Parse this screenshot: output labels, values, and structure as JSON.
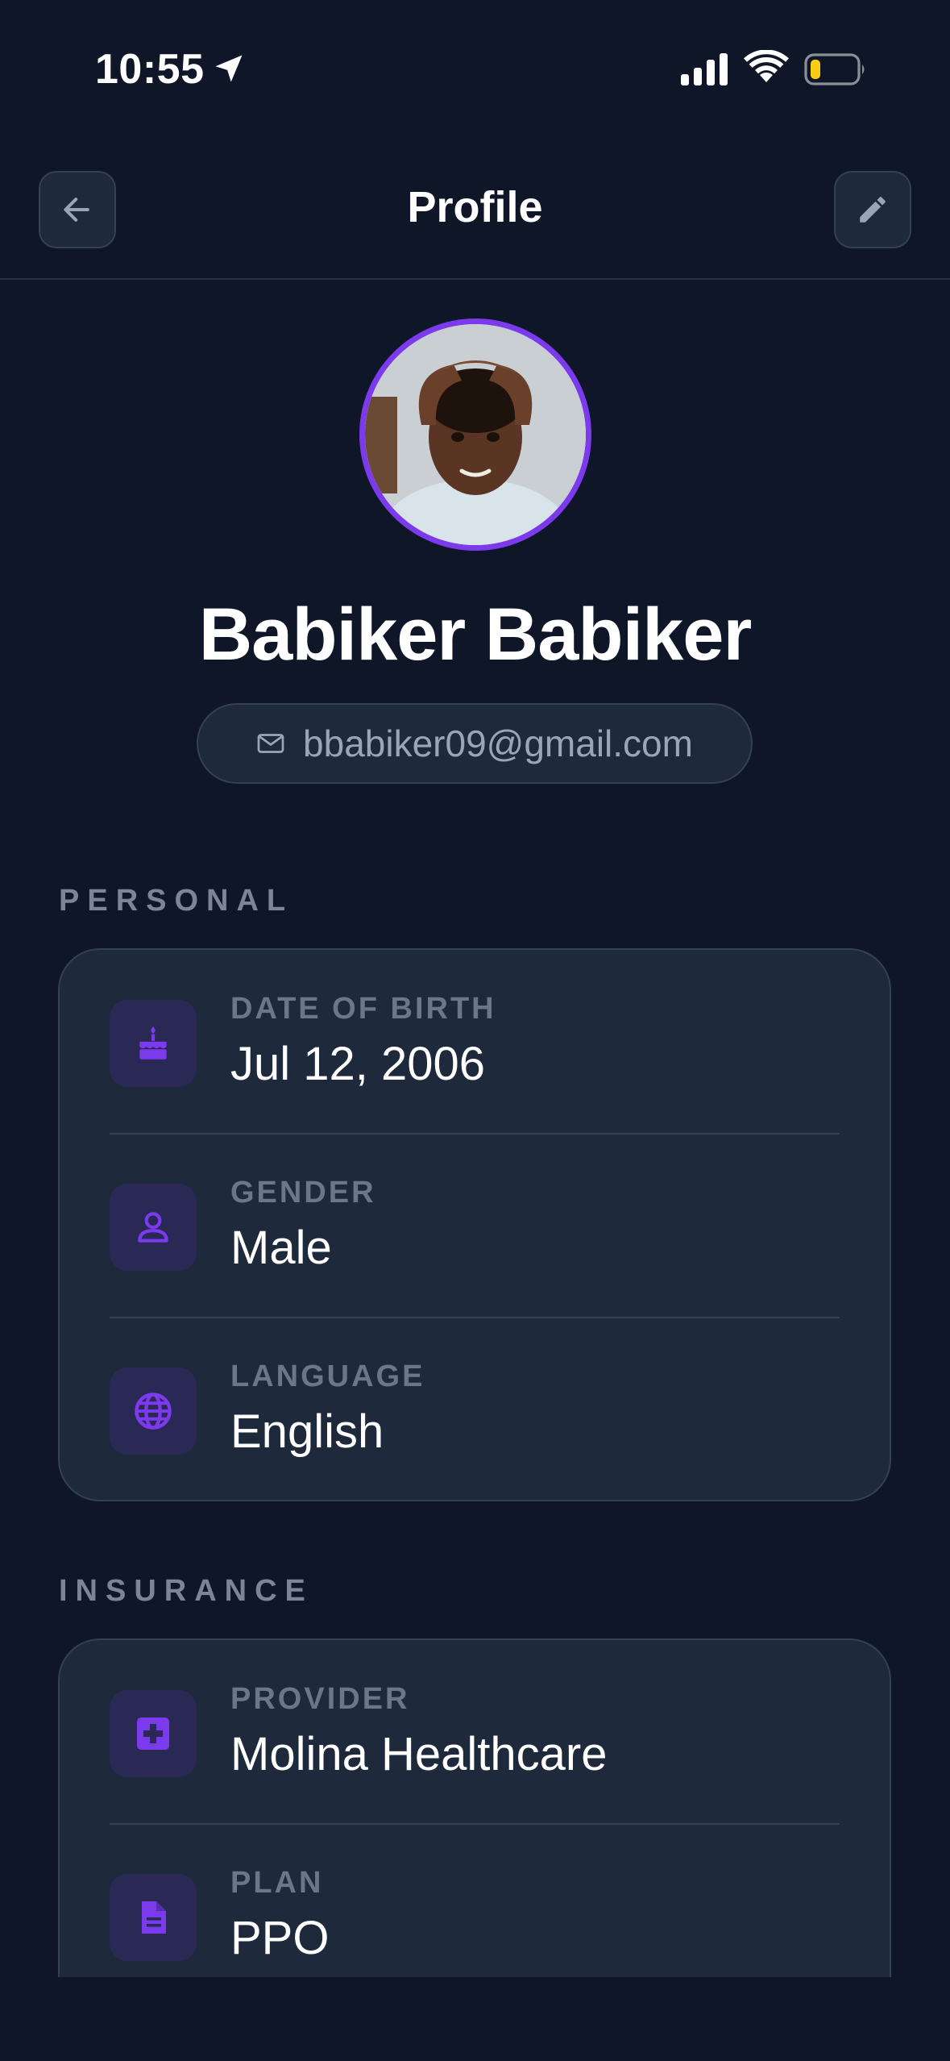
{
  "status_bar": {
    "time": "10:55",
    "battery_color": "#facc15"
  },
  "header": {
    "title": "Profile",
    "back_icon": "arrow-left-icon",
    "edit_icon": "pencil-icon"
  },
  "profile": {
    "name": "Babiker Babiker",
    "email": "bbabiker09@gmail.com",
    "accent_color": "#7c3aed"
  },
  "personal": {
    "section_label": "PERSONAL",
    "items": [
      {
        "label": "DATE OF BIRTH",
        "value": "Jul 12, 2006",
        "icon": "cake-icon"
      },
      {
        "label": "GENDER",
        "value": "Male",
        "icon": "person-icon"
      },
      {
        "label": "LANGUAGE",
        "value": "English",
        "icon": "globe-icon"
      }
    ]
  },
  "insurance": {
    "section_label": "INSURANCE",
    "items": [
      {
        "label": "PROVIDER",
        "value": "Molina Healthcare",
        "icon": "medical-cross-icon"
      },
      {
        "label": "PLAN",
        "value": "PPO",
        "icon": "document-icon"
      }
    ]
  }
}
